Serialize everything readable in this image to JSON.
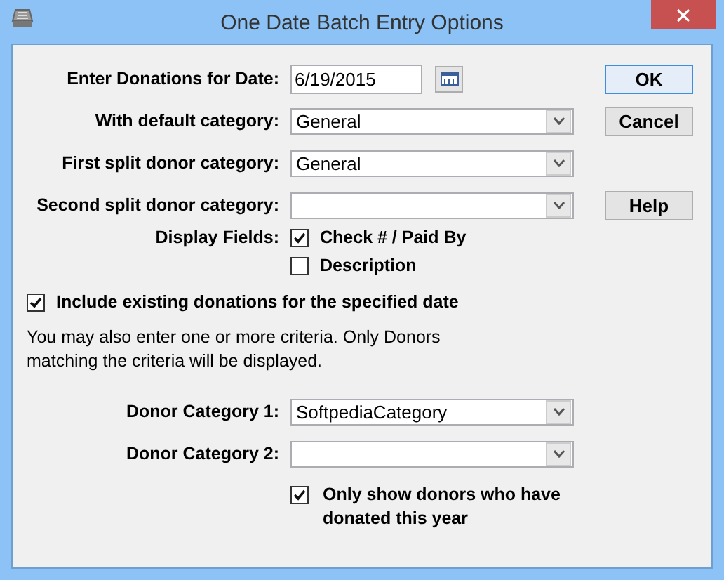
{
  "window": {
    "title": "One Date Batch Entry Options"
  },
  "fields": [
    {
      "kind": "date",
      "label": "Enter Donations for Date:",
      "value": "6/19/2015"
    },
    {
      "kind": "select",
      "label": "With default category:",
      "value": "General"
    },
    {
      "kind": "select",
      "label": "First split donor category:",
      "value": "General"
    },
    {
      "kind": "select",
      "label": "Second split donor category:"
    }
  ],
  "buttons": [
    {
      "label": "OK",
      "default": true
    },
    {
      "label": "Cancel",
      "default": false
    },
    {
      "label": "Help",
      "default": false
    }
  ],
  "display_fields": {
    "label": "Display Fields:",
    "options": [
      {
        "label": "Check # / Paid By",
        "checked": true
      },
      {
        "label": "Description",
        "checked": false
      }
    ]
  },
  "include_existing": {
    "label": "Include existing donations for the specified date",
    "checked": true
  },
  "note": "You may also enter one or more criteria. Only Donors matching the criteria will be displayed.",
  "criteria": [
    {
      "label": "Donor Category 1:",
      "value": "SoftpediaCategory"
    },
    {
      "label": "Donor Category 2:"
    }
  ],
  "only_show": {
    "label": "Only show donors who have donated this year",
    "checked": true
  }
}
